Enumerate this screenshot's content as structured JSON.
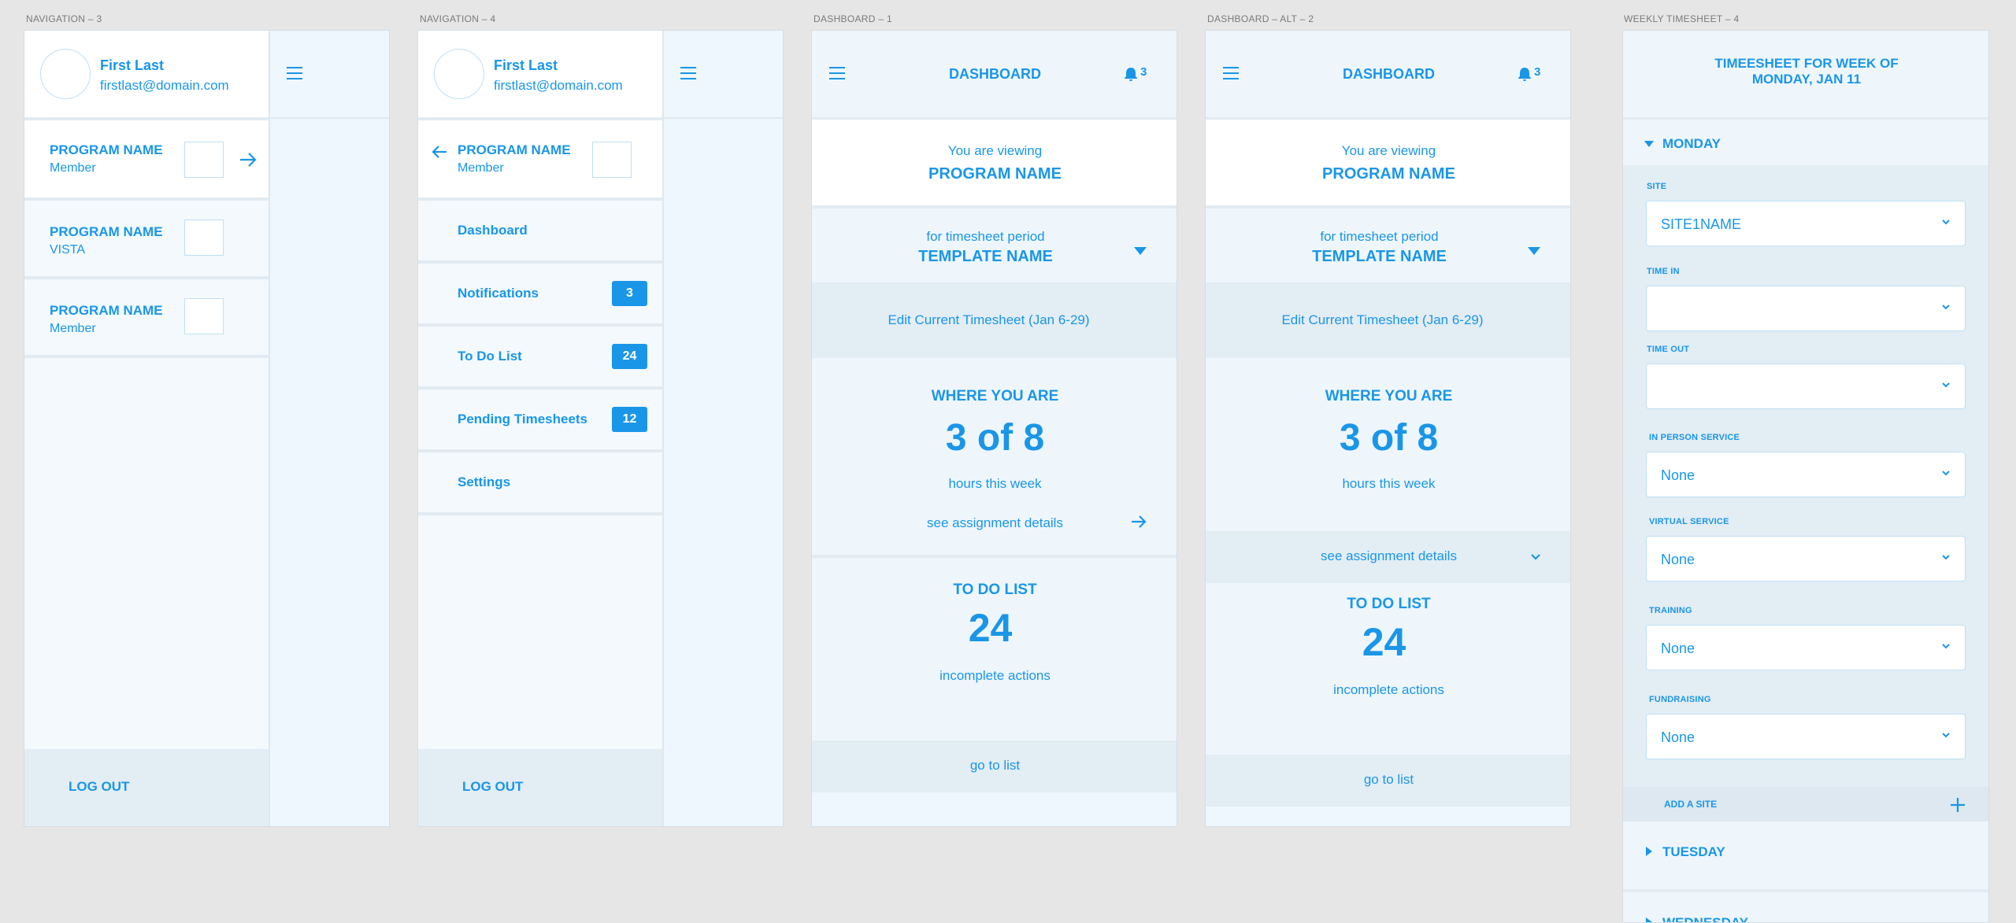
{
  "artboards": [
    {
      "label": "NAVIGATION – 3"
    },
    {
      "label": "NAVIGATION – 4"
    },
    {
      "label": "DASHBOARD – 1"
    },
    {
      "label": "DASHBOARD – ALT – 2"
    },
    {
      "label": "WEEKLY TIMESHEET – 4"
    }
  ],
  "colors": {
    "accent": "#1a96e8",
    "badge_bg": "#1a96e8",
    "background": "#e6e6e6"
  },
  "user": {
    "name": "First Last",
    "email": "firstlast@domain.com"
  },
  "nav3": {
    "programs": [
      {
        "name": "PROGRAM NAME",
        "role": "Member"
      },
      {
        "name": "PROGRAM NAME",
        "role": "VISTA"
      },
      {
        "name": "PROGRAM NAME",
        "role": "Member"
      }
    ],
    "logout": "LOG OUT"
  },
  "nav4": {
    "program": {
      "name": "PROGRAM NAME",
      "role": "Member"
    },
    "menu": [
      {
        "label": "Dashboard",
        "badge": ""
      },
      {
        "label": "Notifications",
        "badge": "3"
      },
      {
        "label": "To Do List",
        "badge": "24"
      },
      {
        "label": "Pending Timesheets",
        "badge": "12"
      },
      {
        "label": "Settings",
        "badge": ""
      }
    ],
    "logout": "LOG OUT"
  },
  "dashboard": {
    "title": "DASHBOARD",
    "notif_count": "3",
    "viewing_label": "You are viewing",
    "program_name": "PROGRAM NAME",
    "period_label": "for timesheet period",
    "template_name": "TEMPLATE NAME",
    "edit_link": "Edit Current Timesheet (Jan 6-29)",
    "where_title": "WHERE YOU ARE",
    "hours_value": "3 of 8",
    "hours_label": "hours this week",
    "assignment_link": "see assignment details",
    "todo_title": "TO DO LIST",
    "todo_count": "24",
    "todo_label": "incomplete actions",
    "go_to_list": "go to list"
  },
  "timesheet": {
    "title_line1": "TIMEESHEET FOR WEEK OF",
    "title_line2": "MONDAY,  JAN 11",
    "day_open": "MONDAY",
    "fields": [
      {
        "label": "SITE",
        "value": "SITE1NAME"
      },
      {
        "label": "TIME IN",
        "value": ""
      },
      {
        "label": "TIME OUT",
        "value": ""
      },
      {
        "label": "IN PERSON SERVICE",
        "value": "None"
      },
      {
        "label": "VIRTUAL SERVICE",
        "value": "None"
      },
      {
        "label": "TRAINING",
        "value": "None"
      },
      {
        "label": "FUNDRAISING",
        "value": "None"
      }
    ],
    "add_site": "ADD A SITE",
    "days_collapsed": [
      "TUESDAY",
      "WEDNESDAY"
    ]
  },
  "icons": [
    "hamburger-icon",
    "arrow-right-icon",
    "arrow-left-icon",
    "bell-icon",
    "caret-down-icon",
    "chevron-down-icon",
    "plus-icon",
    "caret-right-icon"
  ]
}
